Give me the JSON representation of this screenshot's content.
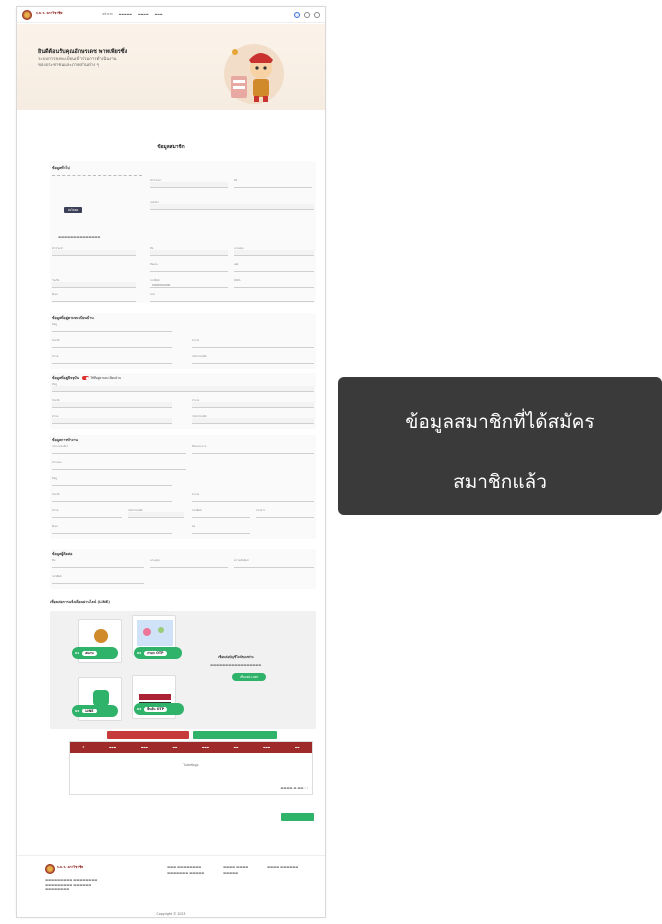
{
  "overlay": {
    "line1": "ข้อมูลสมาชิกที่ได้สมัคร",
    "line2": "สมาชิกแล้ว"
  },
  "header": {
    "brand_title": "ก.ม.ร. สภาวิชาชีพ",
    "brand_sub": "",
    "nav": [
      "หน้าแรก",
      "",
      "",
      ""
    ]
  },
  "hero": {
    "title": "ยินดีต้อนรับคุณอักษรเดช พาทเพียรซึ่ง",
    "desc": "ระบบการลงทะเบียนเข้าร่วมการดำเนินงานของประชาชนและภาคส่วนต่าง ๆ"
  },
  "page_title": "ข้อมูลสมาชิก",
  "sections": {
    "general": "ข้อมูลทั่วไป",
    "address_reg": "ข้อมูลที่อยู่ตามทะเบียนบ้าน",
    "address_cur": "ข้อมูลที่อยู่ปัจจุบัน",
    "same_as": "ใช้ที่อยู่ตามทะเบียนบ้าน",
    "work": "ข้อมูลการทำงาน",
    "other": "ข้อมูลผู้ติดต่อ",
    "line_title": "เชื่อมต่อการแจ้งเตือนผ่านไลน์ (LINE)"
  },
  "general": {
    "upload_btn": "อัปโหลด",
    "upload_note": "",
    "phone": "0000000000",
    "email": "",
    "birth": ""
  },
  "line": {
    "steps": [
      "สแกน",
      "กรอก OTP",
      "LINE",
      "ยืนยัน OTP"
    ],
    "connect_title": "เชื่อมต่อบัญชีไลน์ของท่าน",
    "connect_btn": "เชื่อมต่อ LINE"
  },
  "buttons": {
    "delete": "",
    "add": "",
    "save": ""
  },
  "table": {
    "headers": [
      "#",
      "",
      "",
      "",
      "",
      "",
      "",
      ""
    ],
    "empty": "ไม่พบข้อมูล"
  },
  "footer": {
    "copyright": "Copyright © 2023"
  },
  "colors": {
    "accent": "#9e2a2a",
    "green": "#2fb36b",
    "dark": "#3c3f58",
    "overlay": "#3a3a3a"
  }
}
